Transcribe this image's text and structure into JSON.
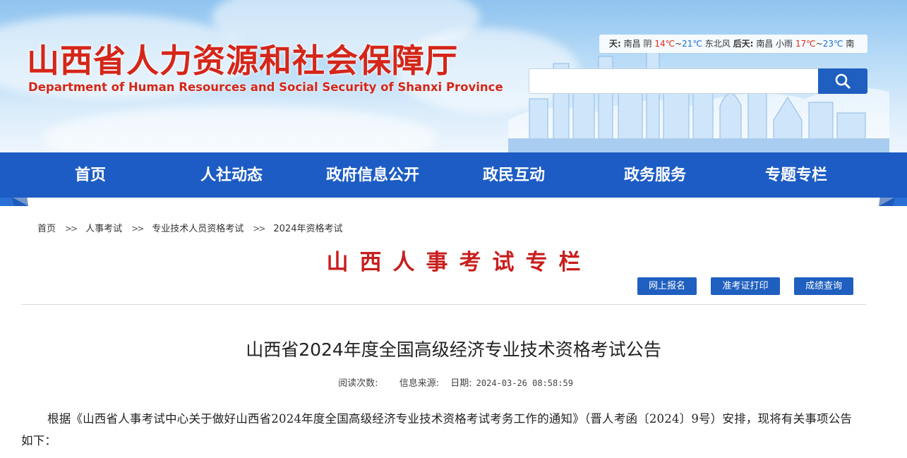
{
  "header": {
    "title": "山西省人力资源和社会保障厅",
    "subtitle": "Department of Human Resources and Social Security of Shanxi Province",
    "weather": {
      "today_label": "天:",
      "today_city": "南昌",
      "today_cond": "阴",
      "today_high": "14℃",
      "today_sep": "~",
      "today_low": "21℃",
      "today_wind": "东北风",
      "tomorrow_label": "后天:",
      "tomorrow_city": "南昌",
      "tomorrow_cond": "小雨",
      "tomorrow_high": "17℃",
      "tomorrow_sep": "~",
      "tomorrow_low": "23℃",
      "tomorrow_tail": "南"
    },
    "search": {
      "placeholder": "",
      "icon": "search-icon"
    }
  },
  "nav": {
    "items": [
      {
        "label": "首页"
      },
      {
        "label": "人社动态"
      },
      {
        "label": "政府信息公开"
      },
      {
        "label": "政民互动"
      },
      {
        "label": "政务服务"
      },
      {
        "label": "专题专栏"
      }
    ]
  },
  "breadcrumb": {
    "separator": ">>",
    "items": [
      {
        "label": "首页"
      },
      {
        "label": "人事考试"
      },
      {
        "label": "专业技术人员资格考试"
      },
      {
        "label": "2024年资格考试"
      }
    ]
  },
  "column": {
    "title": "山西人事考试专栏",
    "buttons": [
      {
        "label": "网上报名"
      },
      {
        "label": "准考证打印"
      },
      {
        "label": "成绩查询"
      }
    ]
  },
  "article": {
    "title": "山西省2024年度全国高级经济专业技术资格考试公告",
    "meta": {
      "views_label": "阅读次数:",
      "views_value": "",
      "source_label": "信息来源:",
      "source_value": "",
      "date_label": "日期:",
      "date_value": "2024-03-26 08:58:59"
    },
    "paragraph": "根据《山西省人事考试中心关于做好山西省2024年度全国高级经济专业技术资格考试考务工作的通知》（晋人考函〔2024〕9号）安排，现将有关事项公告如下："
  },
  "colors": {
    "brand_red": "#d42619",
    "nav_blue": "#1d5cc4",
    "button_blue": "#1f5fbf",
    "column_title_red": "#c81e1e"
  }
}
